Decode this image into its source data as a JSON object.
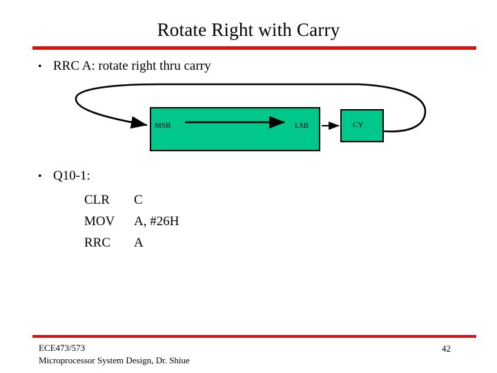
{
  "slide": {
    "title": "Rotate Right with Carry",
    "page_number": "42",
    "accent_color": "#d9100f",
    "register_color": "#00c78c"
  },
  "bullets": [
    {
      "mark": "•",
      "text": "RRC A: rotate right thru carry"
    },
    {
      "mark": "•",
      "text": "Q10-1:"
    }
  ],
  "code": [
    {
      "op": "CLR",
      "arg": "C"
    },
    {
      "op": "MOV",
      "arg": "A, #26H"
    },
    {
      "op": "RRC",
      "arg": "A"
    }
  ],
  "diagram": {
    "accumulator_label_msb": "MSB",
    "accumulator_label_lsb": "LSB",
    "carry_label": "CY",
    "shift_arrow_direction": "right",
    "feedback_loop": "carry-to-msb"
  },
  "footer": {
    "course": "ECE473/573",
    "subtitle": "Microprocessor System Design, Dr. Shiue"
  }
}
